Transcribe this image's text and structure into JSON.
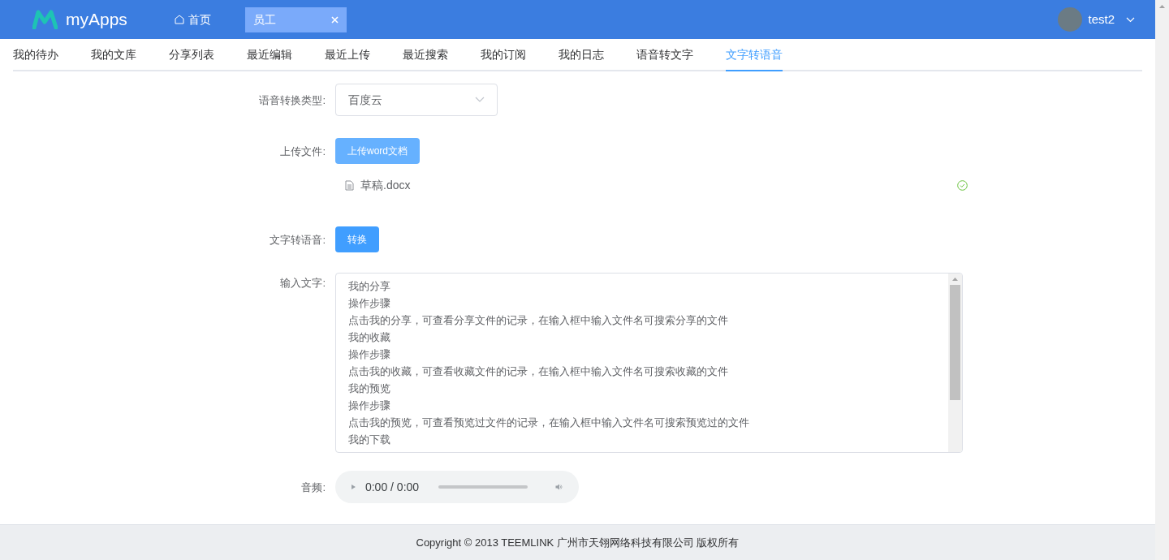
{
  "header": {
    "logo": "myApps",
    "home": "首页",
    "open_tabs": [
      {
        "label": "员工",
        "selected": true
      }
    ],
    "user": "test2"
  },
  "nav_tabs": [
    {
      "label": "我的待办",
      "selected": false
    },
    {
      "label": "我的文库",
      "selected": false
    },
    {
      "label": "分享列表",
      "selected": false
    },
    {
      "label": "最近编辑",
      "selected": false
    },
    {
      "label": "最近上传",
      "selected": false
    },
    {
      "label": "最近搜索",
      "selected": false
    },
    {
      "label": "我的订阅",
      "selected": false
    },
    {
      "label": "我的日志",
      "selected": false
    },
    {
      "label": "语音转文字",
      "selected": false
    },
    {
      "label": "文字转语音",
      "selected": true
    }
  ],
  "form": [
    {
      "kind": "select",
      "label": "语音转换类型:",
      "value": "百度云"
    },
    {
      "kind": "upload",
      "label": "上传文件:",
      "button": "上传word文档",
      "file": "草稿.docx",
      "done": true
    },
    {
      "kind": "button",
      "label": "文字转语音:",
      "button": "转换"
    },
    {
      "kind": "textarea",
      "label": "输入文字:",
      "lines": [
        "我的分享",
        "操作步骤",
        "点击我的分享，可查看分享文件的记录，在输入框中输入文件名可搜索分享的文件",
        "我的收藏",
        "操作步骤",
        "点击我的收藏，可查看收藏文件的记录，在输入框中输入文件名可搜索收藏的文件",
        "我的预览",
        "操作步骤",
        "点击我的预览，可查看预览过文件的记录，在输入框中输入文件名可搜索预览过的文件",
        "我的下载"
      ]
    },
    {
      "kind": "audio",
      "label": "音频:",
      "time": "0:00 / 0:00"
    }
  ],
  "footer": "Copyright © 2013 TEEMLINK 广州市天翎网络科技有限公司 版权所有"
}
